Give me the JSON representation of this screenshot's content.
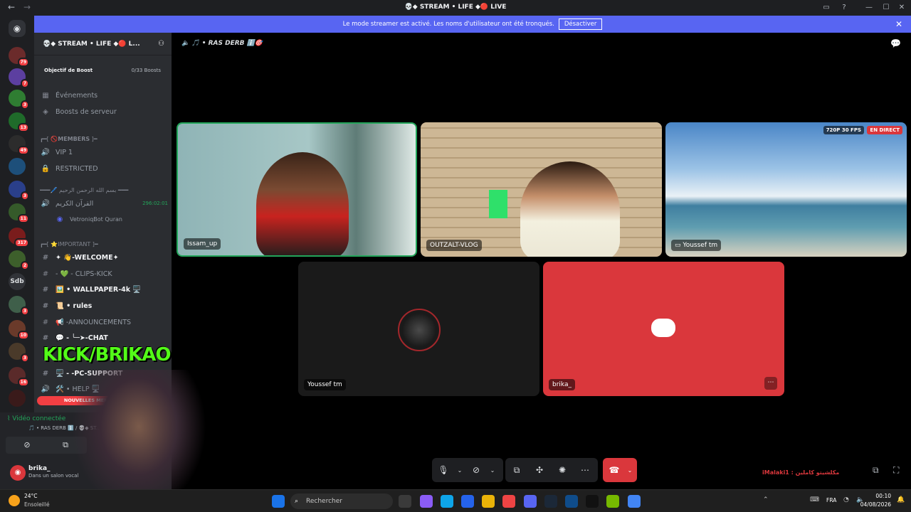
{
  "window": {
    "title": "💀◆ STREAM • LIFE ◆🔴 LIVE"
  },
  "banner": {
    "text": "Le mode streamer est activé. Les noms d'utilisateur ont été tronqués.",
    "button": "Désactiver"
  },
  "server": {
    "name": "💀◆ STREAM • LIFE ◆🔴 L...",
    "boost_label": "Objectif de Boost",
    "boost_value": "0/33 Boosts"
  },
  "channels": {
    "events": "Événements",
    "boosts": "Boosts de serveur",
    "cat1": "┏━[ 🚫𝗠𝗘𝗠𝗕𝗘𝗥𝗦 ]━",
    "vip": "VIP 1",
    "restricted": "RESTRICTED",
    "cat2": "━━━🖊️ بسم الله الرحمن الرحيم ━━━",
    "quran": "القرآن الكريم",
    "quran_time": "296:02:01",
    "bot": "VetroniqBot Quran",
    "cat3": "┏━[ ⭐IMPORTANT ]━",
    "welcome": "✦ 👋-WELCOME✦",
    "clips": "- 💚 - CLIPS-KICK",
    "wallpaper": "🖼️ • WALLPAPER-4k 🖥️",
    "rules": "📜 • rules",
    "announcements": "📢 -ANNOUNCEMENTS",
    "chat": "💬 - ╰─➤-CHAT",
    "pcsupport": "🖥️ - -PC-SUPPORT",
    "help": "🛠️ • HELP 🖥️",
    "new_mentions": "NOUVELLES MENTIONS"
  },
  "voice": {
    "connected": "Vidéo connectée",
    "channel": "🎵 • RAS DERB ℹ️ / 💀◆ ST..."
  },
  "user": {
    "name": "brika_",
    "status": "Dans un salon vocal"
  },
  "stage": {
    "channel": "🎵 • RAS DERB ℹ️🎯"
  },
  "tiles": [
    {
      "name": "Issam_up"
    },
    {
      "name": "OUTZALT-VLOG"
    },
    {
      "name": "Youssef tm",
      "badge": "720P 30 FPS",
      "live": "EN DIRECT"
    },
    {
      "name": "Youssef tm"
    },
    {
      "name": "brika_"
    }
  ],
  "overlay": {
    "kick": "KICK/BRIKAO",
    "watermark": "iMalaki1 : مكلشيتو كاملين"
  },
  "taskbar": {
    "weather_temp": "24°C",
    "weather_text": "Ensoleillé",
    "search": "Rechercher",
    "lang": "FRA",
    "time": "00:10",
    "date": "04/08/2026"
  },
  "colors": {
    "discord_blurple": "#5865f2",
    "red": "#da373c",
    "green": "#23a55a",
    "kick_green": "#53fc18"
  }
}
